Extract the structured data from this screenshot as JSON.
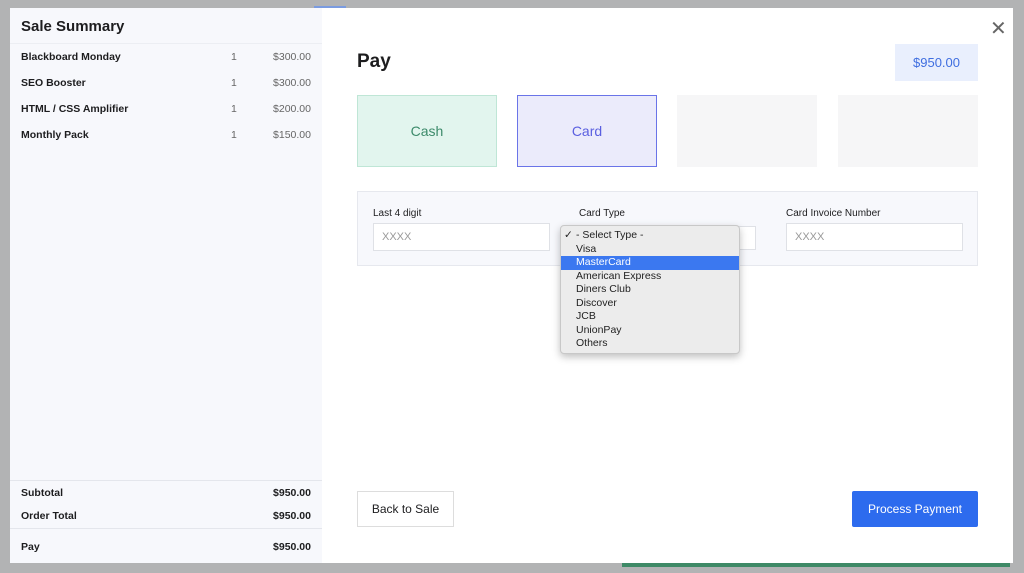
{
  "summary": {
    "title": "Sale Summary",
    "items": [
      {
        "name": "Blackboard Monday",
        "qty": "1",
        "price": "$300.00"
      },
      {
        "name": "SEO Booster",
        "qty": "1",
        "price": "$300.00"
      },
      {
        "name": "HTML / CSS Amplifier",
        "qty": "1",
        "price": "$200.00"
      },
      {
        "name": "Monthly Pack",
        "qty": "1",
        "price": "$150.00"
      }
    ],
    "subtotal_label": "Subtotal",
    "subtotal": "$950.00",
    "order_total_label": "Order Total",
    "order_total": "$950.00",
    "pay_label": "Pay",
    "pay": "$950.00"
  },
  "pay": {
    "title": "Pay",
    "amount": "$950.00",
    "close": "✕",
    "methods": [
      "Cash",
      "Card"
    ],
    "form": {
      "last4_label": "Last 4 digit",
      "last4_placeholder": "XXXX",
      "card_type_label": "Card Type",
      "invoice_label": "Card Invoice Number",
      "invoice_placeholder": "XXXX"
    },
    "card_type_options": [
      "- Select Type -",
      "Visa",
      "MasterCard",
      "American Express",
      "Diners Club",
      "Discover",
      "JCB",
      "UnionPay",
      "Others"
    ],
    "selected_option": "- Select Type -",
    "highlighted_option": "MasterCard",
    "back_label": "Back to Sale",
    "process_label": "Process Payment"
  },
  "colors": {
    "accent": "#2d6bee",
    "cash": "#3c8a6a",
    "card": "#5a5fe0"
  }
}
